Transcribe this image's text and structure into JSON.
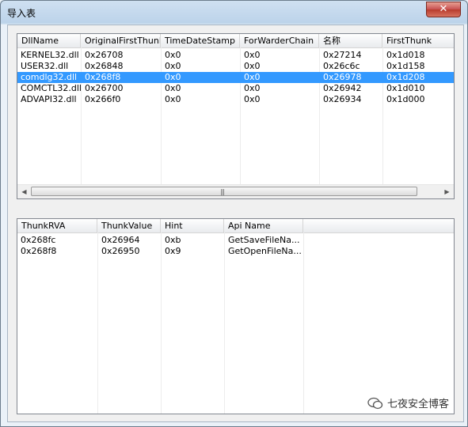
{
  "window": {
    "title": "导入表",
    "close_glyph": "✕"
  },
  "dll_table": {
    "columns": [
      "DllName",
      "OriginalFirstThunk",
      "TimeDateStamp",
      "ForWarderChain",
      "名称",
      "FirstThunk"
    ],
    "rows": [
      [
        "KERNEL32.dll",
        "0x26708",
        "0x0",
        "0x0",
        "0x27214",
        "0x1d018"
      ],
      [
        "USER32.dll",
        "0x26848",
        "0x0",
        "0x0",
        "0x26c6c",
        "0x1d158"
      ],
      [
        "comdlg32.dll",
        "0x268f8",
        "0x0",
        "0x0",
        "0x26978",
        "0x1d208"
      ],
      [
        "COMCTL32.dll",
        "0x26700",
        "0x0",
        "0x0",
        "0x26942",
        "0x1d010"
      ],
      [
        "ADVAPI32.dll",
        "0x266f0",
        "0x0",
        "0x0",
        "0x26934",
        "0x1d000"
      ]
    ],
    "selected_row": "comdlg32.dll",
    "scrollbar": {
      "left_arrow": "◀",
      "right_arrow": "▶",
      "grip": "|||"
    }
  },
  "func_table": {
    "columns": [
      "ThunkRVA",
      "ThunkValue",
      "Hint",
      "Api Name"
    ],
    "rows": [
      [
        "0x268fc",
        "0x26964",
        "0xb",
        "GetSaveFileNa..."
      ],
      [
        "0x268f8",
        "0x26950",
        "0x9",
        "GetOpenFileNa..."
      ]
    ]
  },
  "watermark": {
    "text": "七夜安全博客"
  },
  "colors": {
    "selection": "#3399ff",
    "close_button": "#c75050"
  }
}
